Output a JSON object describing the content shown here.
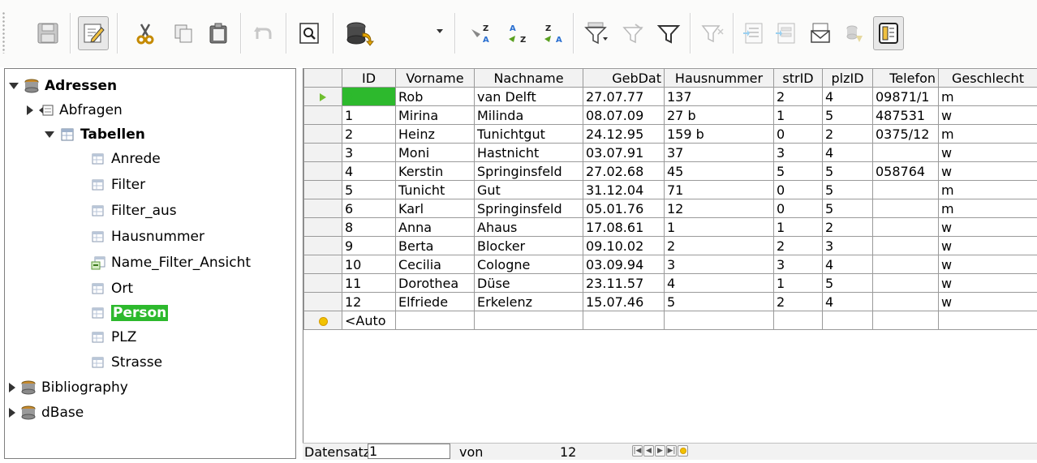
{
  "toolbar": {
    "buttons": [
      {
        "icon": "save-icon"
      },
      {
        "icon": "edit-mode-icon",
        "active": true
      },
      {
        "icon": "cut-icon"
      },
      {
        "icon": "copy-icon"
      },
      {
        "icon": "paste-icon"
      },
      {
        "icon": "undo-icon"
      },
      {
        "icon": "find-record-icon"
      },
      {
        "icon": "refresh-icon"
      },
      {
        "icon": "sort-icon"
      },
      {
        "icon": "sort-ascending-icon"
      },
      {
        "icon": "sort-descending-icon"
      },
      {
        "icon": "autofilter-icon"
      },
      {
        "icon": "apply-filter-icon"
      },
      {
        "icon": "standard-filter-icon"
      },
      {
        "icon": "reset-filter-icon"
      },
      {
        "icon": "data-to-text-icon"
      },
      {
        "icon": "data-to-fields-icon"
      },
      {
        "icon": "mail-merge-icon"
      },
      {
        "icon": "data-source-of-document-icon"
      },
      {
        "icon": "explorer-toggle-icon",
        "active": true
      }
    ]
  },
  "tree": {
    "items": [
      {
        "label": "Adressen",
        "level": 0,
        "expander": "open",
        "icon": "database-icon",
        "bold": true
      },
      {
        "label": "Abfragen",
        "level": 1,
        "expander": "closed",
        "icon": "queries-icon"
      },
      {
        "label": "Tabellen",
        "level": 1,
        "expander": "open",
        "icon": "tables-icon",
        "bold": true
      },
      {
        "label": "Anrede",
        "level": 2,
        "icon": "table-icon"
      },
      {
        "label": "Filter",
        "level": 2,
        "icon": "table-icon"
      },
      {
        "label": "Filter_aus",
        "level": 2,
        "icon": "table-icon"
      },
      {
        "label": "Hausnummer",
        "level": 2,
        "icon": "table-icon"
      },
      {
        "label": "Name_Filter_Ansicht",
        "level": 2,
        "icon": "view-icon"
      },
      {
        "label": "Ort",
        "level": 2,
        "icon": "table-icon"
      },
      {
        "label": "Person",
        "level": 2,
        "icon": "table-icon",
        "selected": true
      },
      {
        "label": "PLZ",
        "level": 2,
        "icon": "table-icon"
      },
      {
        "label": "Strasse",
        "level": 2,
        "icon": "table-icon"
      },
      {
        "label": "Bibliography",
        "level": 0,
        "expander": "closed",
        "icon": "database-icon"
      },
      {
        "label": "dBase",
        "level": 0,
        "expander": "closed",
        "icon": "database-icon"
      }
    ]
  },
  "grid": {
    "columns": [
      "ID",
      "Vorname",
      "Nachname",
      "GebDat",
      "Hausnummer",
      "strID",
      "plzID",
      "Telefon",
      "Geschlecht"
    ],
    "rows": [
      [
        "0",
        "Rob",
        "van Delft",
        "27.07.77",
        "137",
        "2",
        "4",
        "09871/1",
        "m"
      ],
      [
        "1",
        "Mirina",
        "Milinda",
        "08.07.09",
        "27 b",
        "1",
        "5",
        "487531",
        "w"
      ],
      [
        "2",
        "Heinz",
        "Tunichtgut",
        "24.12.95",
        "159 b",
        "0",
        "2",
        "0375/12",
        "m"
      ],
      [
        "3",
        "Moni",
        "Hastnicht",
        "03.07.91",
        "37",
        "3",
        "4",
        "",
        "w"
      ],
      [
        "4",
        "Kerstin",
        "Springinsfeld",
        "27.02.68",
        "45",
        "5",
        "5",
        "058764",
        "w"
      ],
      [
        "5",
        "Tunicht",
        "Gut",
        "31.12.04",
        "71",
        "0",
        "5",
        "",
        "m"
      ],
      [
        "6",
        "Karl",
        "Springinsfeld",
        "05.01.76",
        "12",
        "0",
        "5",
        "",
        "m"
      ],
      [
        "8",
        "Anna",
        "Ahaus",
        "17.08.61",
        "1",
        "1",
        "2",
        "",
        "w"
      ],
      [
        "9",
        "Berta",
        "Blocker",
        "09.10.02",
        "2",
        "2",
        "3",
        "",
        "w"
      ],
      [
        "10",
        "Cecilia",
        "Cologne",
        "03.09.94",
        "3",
        "3",
        "4",
        "",
        "w"
      ],
      [
        "11",
        "Dorothea",
        "Düse",
        "23.11.57",
        "4",
        "1",
        "5",
        "",
        "w"
      ],
      [
        "12",
        "Elfriede",
        "Erkelenz",
        "15.07.46",
        "5",
        "2",
        "4",
        "",
        "w"
      ]
    ],
    "new_row_placeholder": "<Auto"
  },
  "navbar": {
    "record_label": "Datensatz",
    "record_value": "1",
    "of_label": "von",
    "total": "12"
  }
}
